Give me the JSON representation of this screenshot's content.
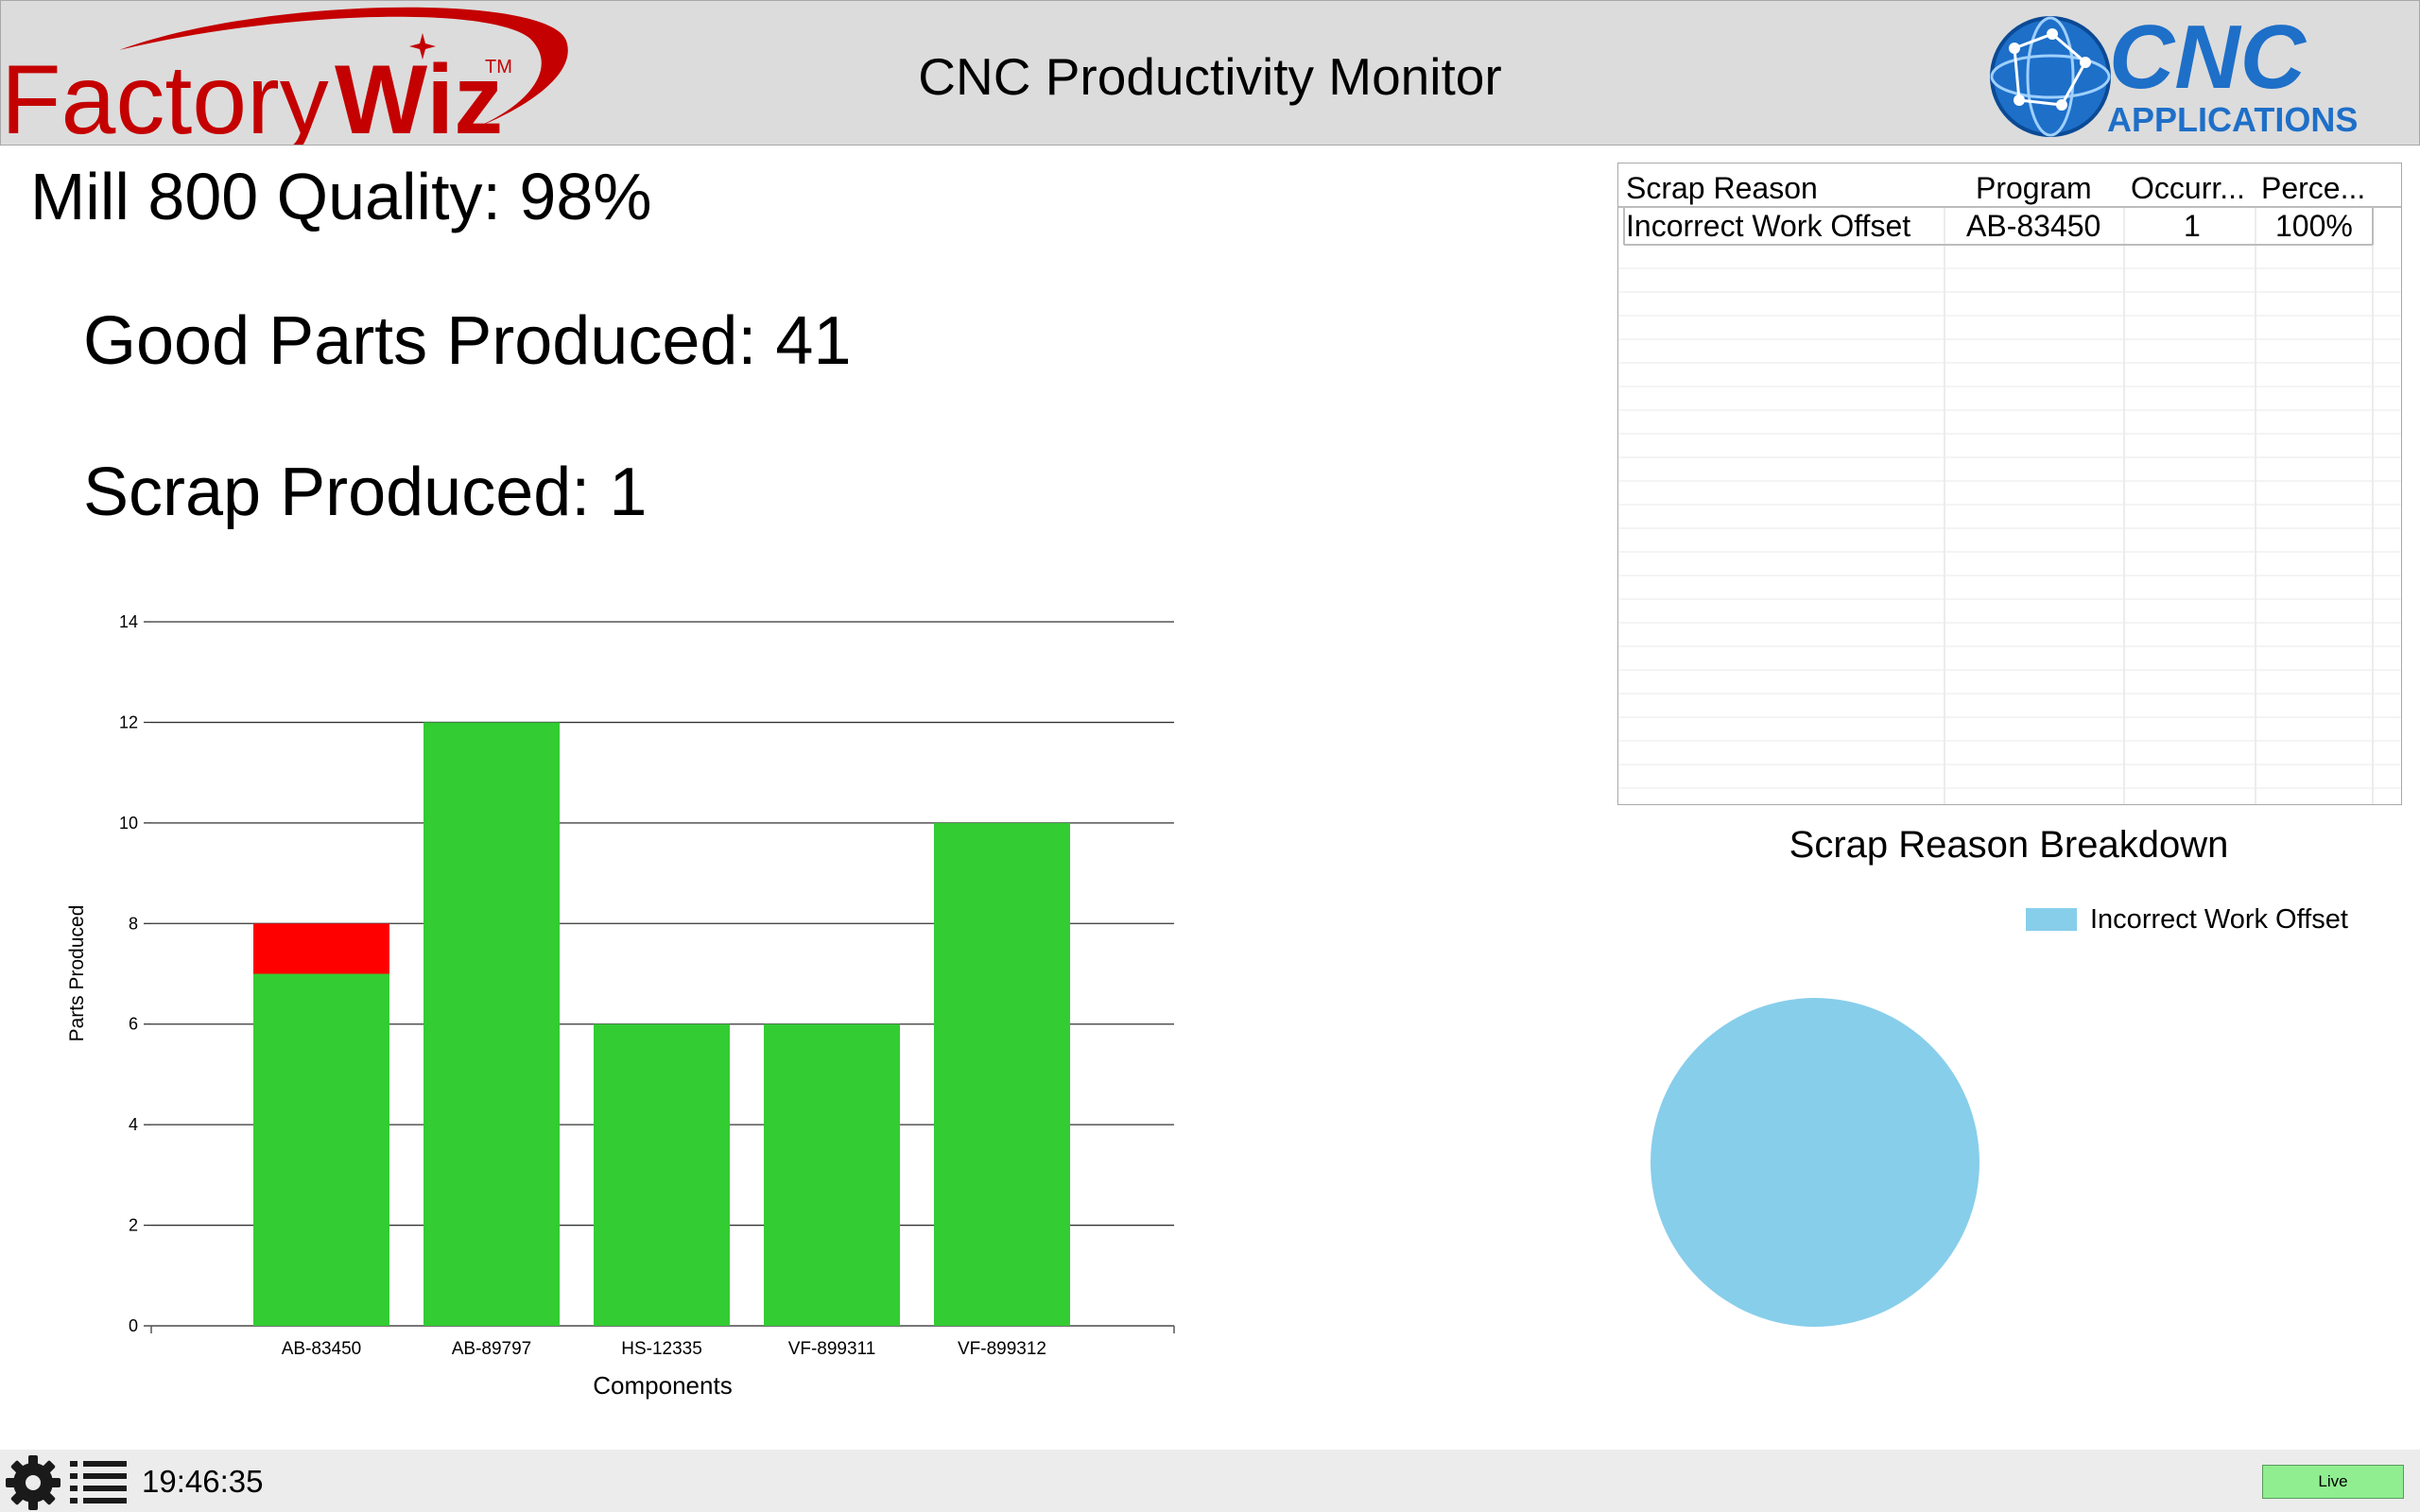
{
  "header": {
    "title": "CNC Productivity Monitor",
    "logo_left": {
      "text_plain": "Factory",
      "text_bold": "Wiz",
      "trademark": "TM",
      "text": "FactoryWiz"
    },
    "logo_right": {
      "text_main": "CNC",
      "text_sub": "APPLICATIONS",
      "text": "CNC APPLICATIONS"
    }
  },
  "stats": {
    "quality": "Mill 800 Quality: 98%",
    "good_parts": "Good Parts Produced: 41",
    "scrap": "Scrap Produced: 1"
  },
  "table": {
    "columns": [
      "Scrap Reason",
      "Program",
      "Occurr...",
      "Perce..."
    ],
    "rows": [
      {
        "reason": "Incorrect Work Offset",
        "program": "AB-83450",
        "occurrences": "1",
        "percent": "100%"
      }
    ]
  },
  "chart_data": [
    {
      "type": "bar",
      "stacked": true,
      "categories": [
        "AB-83450",
        "AB-89797",
        "HS-12335",
        "VF-899311",
        "VF-899312"
      ],
      "series": [
        {
          "name": "",
          "values": [
            7,
            12,
            6,
            6,
            10
          ],
          "color": "#33cc33"
        },
        {
          "name": "",
          "values": [
            1,
            0,
            0,
            0,
            0
          ],
          "color": "#ff0000"
        }
      ],
      "xlabel": "Components",
      "ylabel": "Parts Produced",
      "ylim": [
        0,
        14
      ],
      "yticks": [
        0,
        2,
        4,
        6,
        8,
        10,
        12,
        14
      ],
      "grid": true
    },
    {
      "type": "pie",
      "title": "Scrap Reason Breakdown",
      "labels": [
        "Incorrect Work Offset"
      ],
      "values": [
        1
      ],
      "colors": [
        "#87ceeb"
      ],
      "legend": "top-right"
    }
  ],
  "status_bar": {
    "time": "19:46:35",
    "live_label": "Live",
    "settings_icon": "gear-icon",
    "menu_icon": "list-menu-icon"
  },
  "colors": {
    "good": "#33cc33",
    "scrap": "#ff0000",
    "pie": "#87ceeb",
    "header_bg": "#dcdcdc",
    "brand_red": "#cc0000",
    "brand_blue": "#1e6fc8",
    "live": "#90ee90"
  }
}
